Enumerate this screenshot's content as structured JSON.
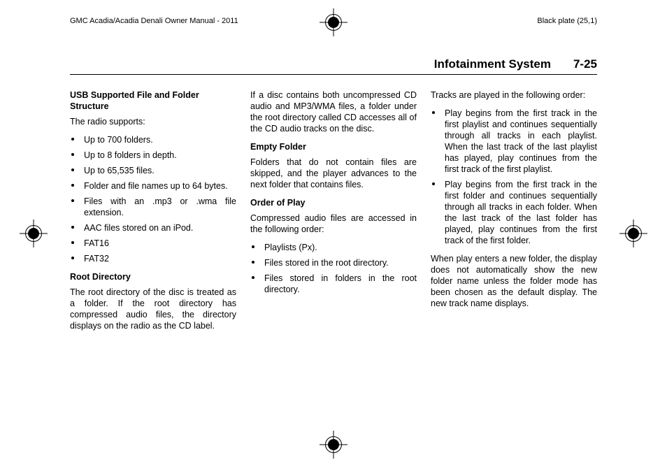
{
  "meta": {
    "doc_title": "GMC Acadia/Acadia Denali Owner Manual - 2011",
    "plate": "Black plate (25,1)"
  },
  "running_head": {
    "section": "Infotainment System",
    "page": "7-25"
  },
  "col1": {
    "h1": "USB Supported File and Folder Structure",
    "intro": "The radio supports:",
    "bullets": [
      "Up to 700 folders.",
      "Up to 8 folders in depth.",
      "Up to 65,535 files.",
      "Folder and file names up to 64 bytes.",
      "Files with an .mp3 or .wma file extension.",
      "AAC files stored on an iPod.",
      "FAT16",
      "FAT32"
    ],
    "h2": "Root Directory",
    "root_body": "The root directory of the disc is treated as a folder. If the root directory has compressed audio files, the directory displays on the radio as the CD label."
  },
  "col2": {
    "mixed_body": "If a disc contains both uncompressed CD audio and MP3/WMA files, a folder under the root directory called CD accesses all of the CD audio tracks on the disc.",
    "h_empty": "Empty Folder",
    "empty_body": "Folders that do not contain files are skipped, and the player advances to the next folder that contains files.",
    "h_order": "Order of Play",
    "order_intro": "Compressed audio files are accessed in the following order:",
    "order_list": [
      "Playlists (Px).",
      "Files stored in the root directory.",
      "Files stored in folders in the root directory."
    ]
  },
  "col3": {
    "intro": "Tracks are played in the following order:",
    "bullets": [
      "Play begins from the first track in the first playlist and continues sequentially through all tracks in each playlist. When the last track of the last playlist has played, play continues from the first track of the first playlist.",
      "Play begins from the first track in the first folder and continues sequentially through all tracks in each folder. When the last track of the last folder has played, play continues from the first track of the first folder."
    ],
    "outro": "When play enters a new folder, the display does not automatically show the new folder name unless the folder mode has been chosen as the default display. The new track name displays."
  }
}
